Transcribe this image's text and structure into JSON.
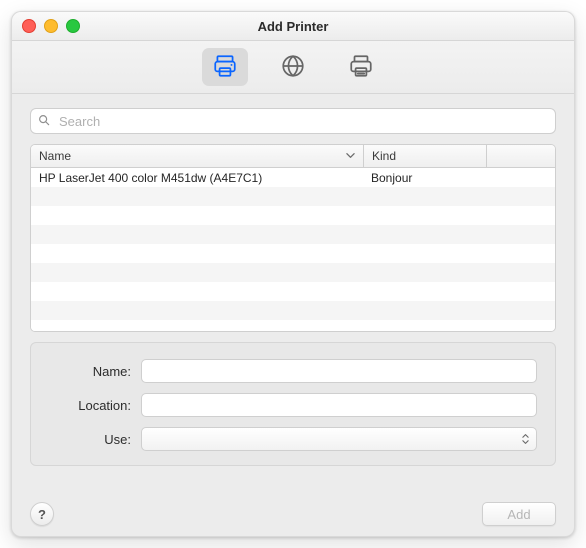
{
  "window": {
    "title": "Add Printer"
  },
  "traffic": {
    "close": "close",
    "minimize": "minimize",
    "zoom": "zoom"
  },
  "tabs": {
    "default": {
      "name": "default-printer",
      "active": true
    },
    "ip": {
      "name": "ip-printer",
      "active": false
    },
    "windows": {
      "name": "windows-printer",
      "active": false
    }
  },
  "search": {
    "placeholder": "Search",
    "value": ""
  },
  "table": {
    "columns": {
      "name": "Name",
      "kind": "Kind"
    },
    "rows": [
      {
        "name": "HP LaserJet 400 color M451dw (A4E7C1)",
        "kind": "Bonjour"
      }
    ],
    "blank_rows": 8
  },
  "form": {
    "labels": {
      "name": "Name:",
      "location": "Location:",
      "use": "Use:"
    },
    "values": {
      "name": "",
      "location": "",
      "use": ""
    }
  },
  "buttons": {
    "help": "?",
    "add": "Add"
  },
  "colors": {
    "accent": "#0a65ff"
  }
}
